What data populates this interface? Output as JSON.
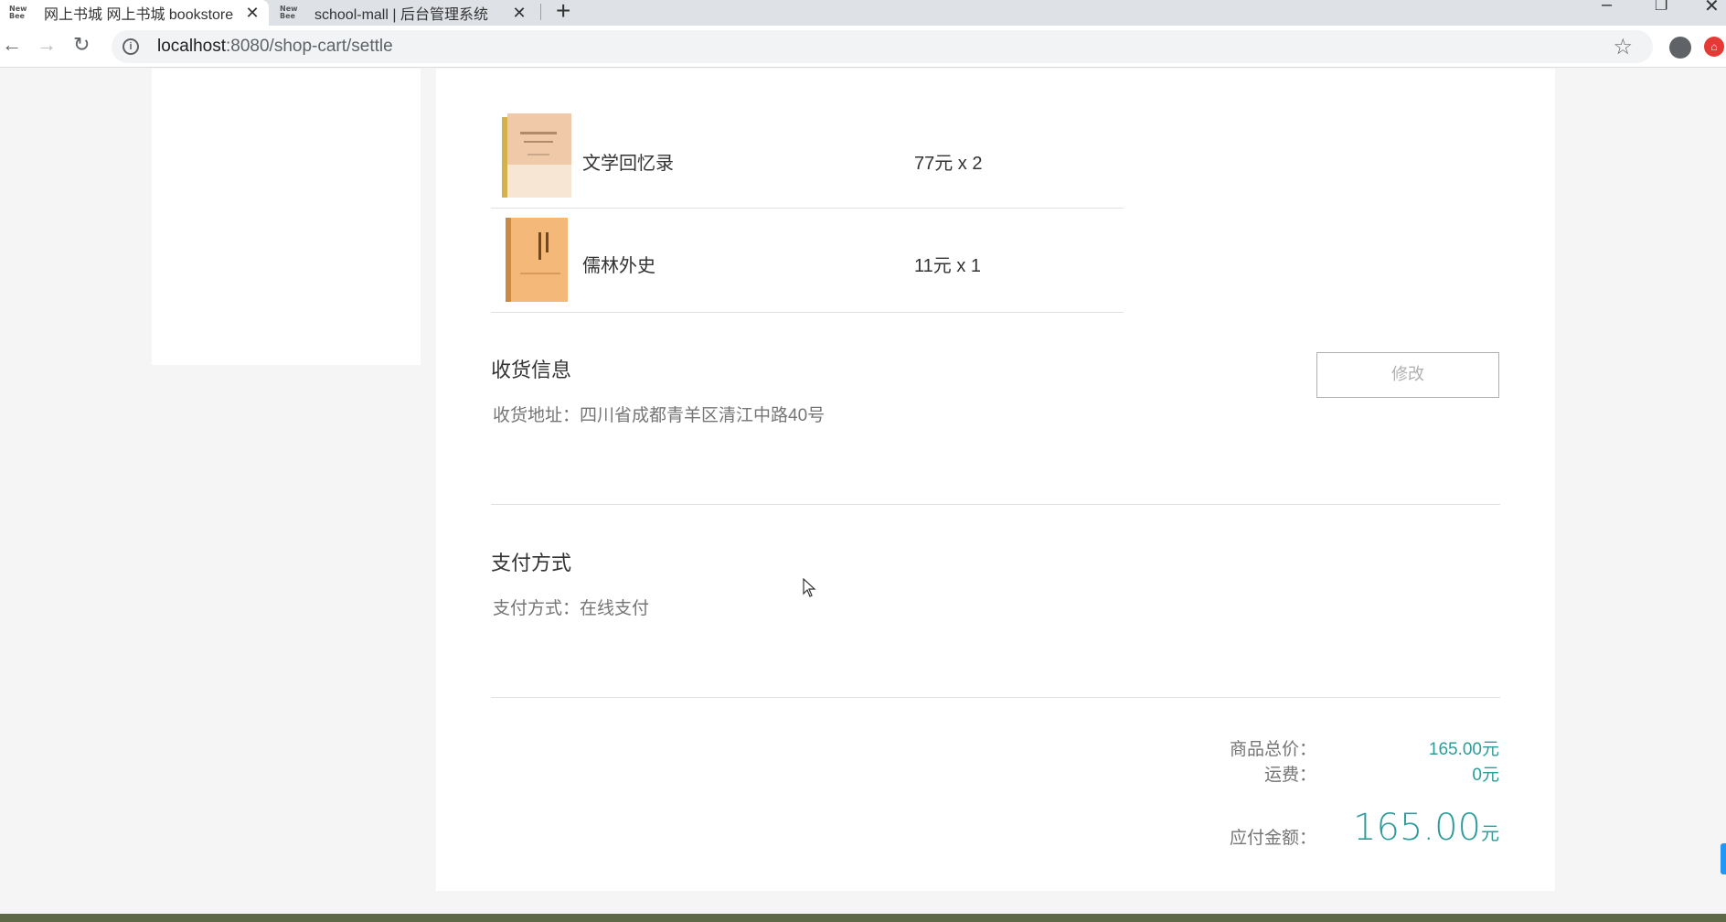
{
  "browser": {
    "tabs": [
      {
        "favicon": "New Bee",
        "title": "网上书城 网上书城 bookstore"
      },
      {
        "favicon": "New Bee",
        "title": "school-mall | 后台管理系统"
      }
    ],
    "url_host": "localhost",
    "url_path": ":8080/shop-cart/settle"
  },
  "goods": [
    {
      "name": "文学回忆录",
      "price": "77元 x 2",
      "cover_color": "#f0c9a8"
    },
    {
      "name": "儒林外史",
      "price": "11元 x 1",
      "cover_color": "#f4b979"
    }
  ],
  "address": {
    "title": "收货信息",
    "label": "收货地址：",
    "value": "四川省成都青羊区清江中路40号",
    "edit_label": "修改"
  },
  "payment": {
    "title": "支付方式",
    "label": "支付方式：",
    "value": "在线支付"
  },
  "summary": {
    "goods_total_label": "商品总价：",
    "goods_total_value": "165.00元",
    "shipping_label": "运费：",
    "shipping_value": "0元",
    "payable_label": "应付金额：",
    "payable_value": "165.00",
    "payable_unit": "元"
  },
  "colors": {
    "accent": "#2d9c9a",
    "footer": "#5e6a47"
  }
}
